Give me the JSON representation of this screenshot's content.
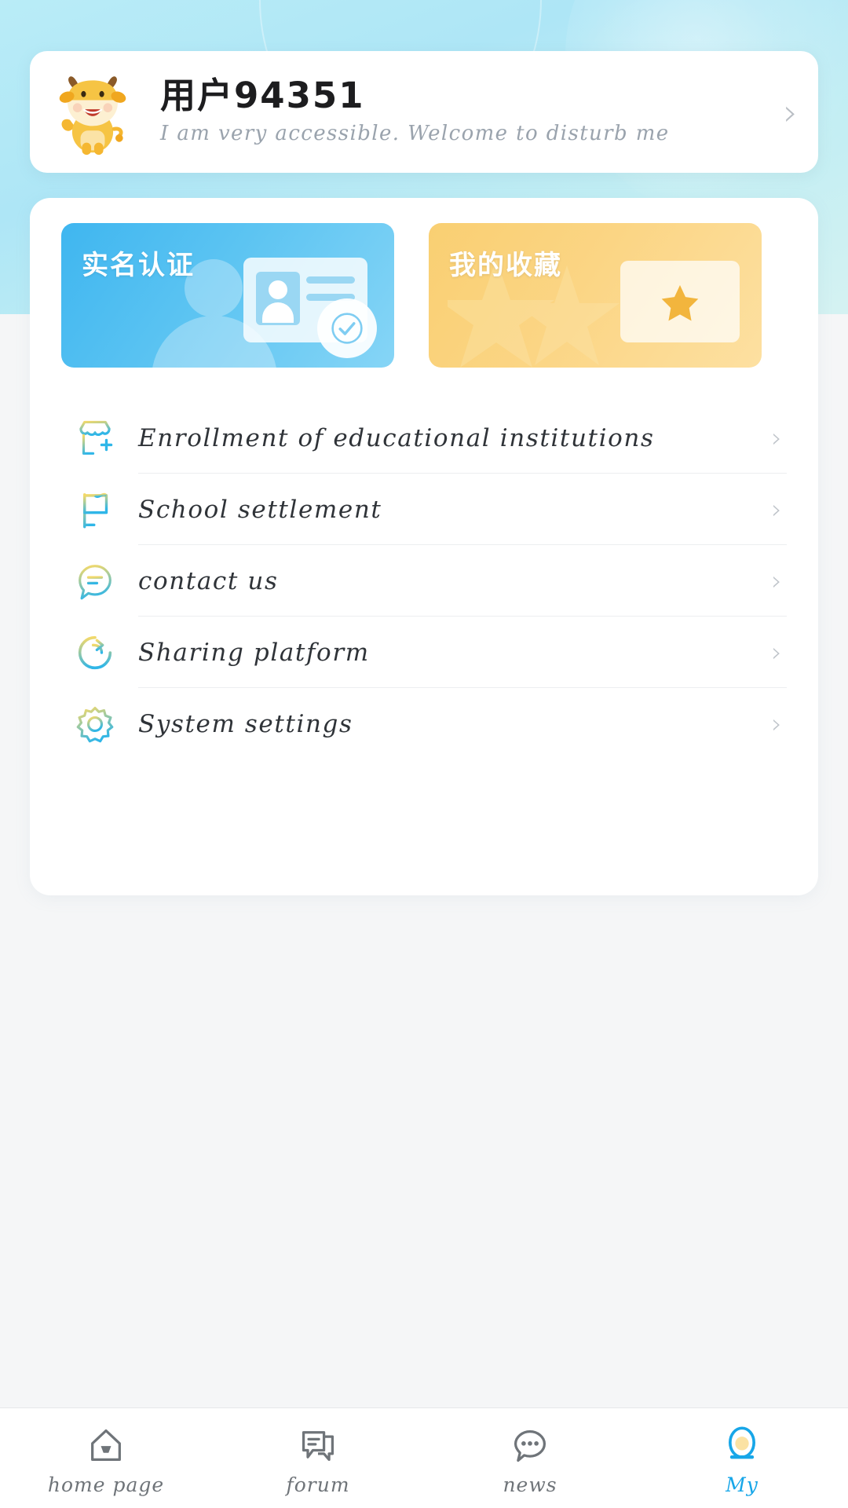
{
  "theme": {
    "header_gradient_from": "#b9ecf7",
    "header_gradient_to": "#d5f2f2",
    "card_blue_from": "#3fb6f0",
    "card_blue_to": "#86d5f6",
    "card_amber_from": "#f9cf72",
    "card_amber_to": "#fde0a1",
    "accent_active": "#17a6e8",
    "text_primary": "#1d1d1f",
    "text_muted": "#9aa3ad",
    "divider": "#eceef0",
    "panel_bg": "#ffffff",
    "page_bg": "#f5f6f7"
  },
  "profile": {
    "avatar_icon": "cow-mascot-avatar",
    "name": "用户94351",
    "signature": "I am very accessible. Welcome to disturb me",
    "chevron_icon": "chevron-right-icon"
  },
  "feature_cards": [
    {
      "title": "实名认证",
      "icon": "id-card-verified-icon",
      "color": "blue"
    },
    {
      "title": "我的收藏",
      "icon": "star-folder-icon",
      "color": "amber"
    }
  ],
  "menu": {
    "items": [
      {
        "label": "Enrollment of educational institutions",
        "icon": "store-add-icon",
        "chevron": "chevron-right-icon"
      },
      {
        "label": "School settlement",
        "icon": "flag-icon",
        "chevron": "chevron-right-icon"
      },
      {
        "label": "contact us",
        "icon": "chat-bubble-lines-icon",
        "chevron": "chevron-right-icon"
      },
      {
        "label": "Sharing platform",
        "icon": "share-refresh-icon",
        "chevron": "chevron-right-icon"
      },
      {
        "label": "System settings",
        "icon": "gear-icon",
        "chevron": "chevron-right-icon"
      }
    ]
  },
  "tabbar": {
    "items": [
      {
        "label": "home page",
        "icon": "home-icon",
        "active": false
      },
      {
        "label": "forum",
        "icon": "forum-icon",
        "active": false
      },
      {
        "label": "news",
        "icon": "news-chat-icon",
        "active": false
      },
      {
        "label": "My",
        "icon": "user-profile-icon",
        "active": true
      }
    ]
  }
}
